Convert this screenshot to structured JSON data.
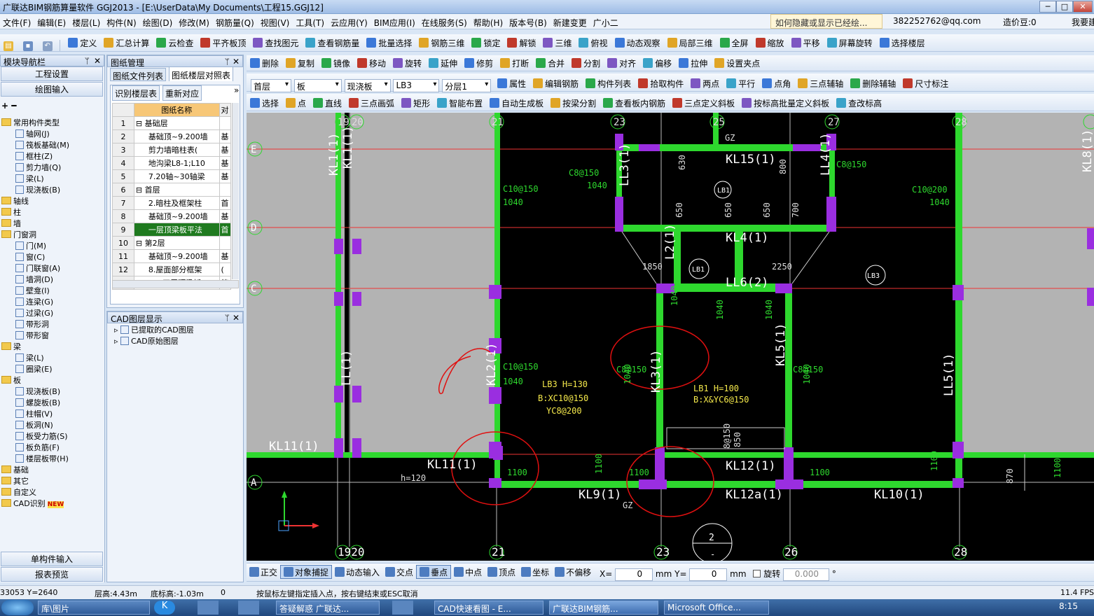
{
  "window": {
    "title": "广联达BIM钢筋算量软件 GGJ2013 - [E:\\UserData\\My Documents\\工程15.GGJ12]",
    "min": "─",
    "max": "□",
    "close": "✕"
  },
  "menu": [
    "文件(F)",
    "编辑(E)",
    "楼层(L)",
    "构件(N)",
    "绘图(D)",
    "修改(M)",
    "钢筋量(Q)",
    "视图(V)",
    "工具(T)",
    "云应用(Y)",
    "BIM应用(I)",
    "在线服务(S)",
    "帮助(H)",
    "版本号(B)",
    "新建变更",
    "广小二"
  ],
  "menu_right": {
    "hint": "如何隐藏或显示已经绘...",
    "account": "382252762@qq.com",
    "beans": "造价豆:0",
    "help": "我要建"
  },
  "toolbar1": [
    "定义",
    "汇总计算",
    "云检查",
    "平齐板顶",
    "查找图元",
    "查看钢筋量",
    "批量选择",
    "钢筋三维",
    "锁定",
    "解锁",
    "三维",
    "俯视",
    "动态观察",
    "局部三维",
    "全屏",
    "缩放",
    "平移",
    "屏幕旋转",
    "选择楼层"
  ],
  "toolbar2": [
    "删除",
    "复制",
    "镜像",
    "移动",
    "旋转",
    "延伸",
    "修剪",
    "打断",
    "合并",
    "分割",
    "对齐",
    "偏移",
    "拉伸",
    "设置夹点"
  ],
  "toolbar3": {
    "floor": "首层",
    "type": "板",
    "subtype": "现浇板",
    "name": "LB3",
    "layer": "分层1",
    "buttons": [
      "属性",
      "编辑钢筋",
      "构件列表",
      "拾取构件",
      "两点",
      "平行",
      "点角",
      "三点辅轴",
      "删除辅轴",
      "尺寸标注"
    ]
  },
  "toolbar4": [
    "选择",
    "点",
    "直线",
    "三点画弧",
    "矩形",
    "智能布置",
    "自动生成板",
    "按梁分割",
    "查看板内钢筋",
    "三点定义斜板",
    "按标高批量定义斜板",
    "查改标高"
  ],
  "nav": {
    "title": "模块导航栏",
    "pin": "ᛘ",
    "close": "✕",
    "btn1": "工程设置",
    "btn2": "绘图输入",
    "btn3": "单构件输入",
    "btn4": "报表预览",
    "tree": [
      {
        "lvl": 0,
        "fold": true,
        "label": "常用构件类型"
      },
      {
        "lvl": 1,
        "label": "轴网(J)"
      },
      {
        "lvl": 1,
        "label": "筏板基础(M)"
      },
      {
        "lvl": 1,
        "label": "框柱(Z)"
      },
      {
        "lvl": 1,
        "label": "剪力墙(Q)"
      },
      {
        "lvl": 1,
        "label": "梁(L)"
      },
      {
        "lvl": 1,
        "label": "现浇板(B)"
      },
      {
        "lvl": 0,
        "fold": true,
        "label": "轴线"
      },
      {
        "lvl": 0,
        "fold": true,
        "label": "柱"
      },
      {
        "lvl": 0,
        "fold": true,
        "label": "墙"
      },
      {
        "lvl": 0,
        "fold": true,
        "label": "门窗洞"
      },
      {
        "lvl": 1,
        "label": "门(M)"
      },
      {
        "lvl": 1,
        "label": "窗(C)"
      },
      {
        "lvl": 1,
        "label": "门联窗(A)"
      },
      {
        "lvl": 1,
        "label": "墙洞(D)"
      },
      {
        "lvl": 1,
        "label": "壁龛(I)"
      },
      {
        "lvl": 1,
        "label": "连梁(G)"
      },
      {
        "lvl": 1,
        "label": "过梁(G)"
      },
      {
        "lvl": 1,
        "label": "带形洞"
      },
      {
        "lvl": 1,
        "label": "带形窗"
      },
      {
        "lvl": 0,
        "fold": true,
        "label": "梁"
      },
      {
        "lvl": 1,
        "label": "梁(L)"
      },
      {
        "lvl": 1,
        "label": "圈梁(E)"
      },
      {
        "lvl": 0,
        "fold": true,
        "label": "板"
      },
      {
        "lvl": 1,
        "label": "现浇板(B)"
      },
      {
        "lvl": 1,
        "label": "螺旋板(B)"
      },
      {
        "lvl": 1,
        "label": "柱帽(V)"
      },
      {
        "lvl": 1,
        "label": "板洞(N)"
      },
      {
        "lvl": 1,
        "label": "板受力筋(S)"
      },
      {
        "lvl": 1,
        "label": "板负筋(F)"
      },
      {
        "lvl": 1,
        "label": "楼层板带(H)"
      },
      {
        "lvl": 0,
        "fold": true,
        "label": "基础"
      },
      {
        "lvl": 0,
        "fold": true,
        "label": "其它"
      },
      {
        "lvl": 0,
        "fold": true,
        "label": "自定义"
      },
      {
        "lvl": 0,
        "fold": true,
        "label": "CAD识别",
        "badge": "NEW"
      }
    ]
  },
  "drawing": {
    "title": "图纸管理",
    "tab1": "图纸文件列表",
    "tab2": "图纸楼层对照表",
    "btn1": "识别楼层表",
    "btn2": "重新对应",
    "col_name": "图纸名称",
    "col2": "对",
    "rows": [
      {
        "n": "1",
        "name": "基础层",
        "c": "",
        "group": true
      },
      {
        "n": "2",
        "name": "基础顶~9.200墙",
        "c": "基"
      },
      {
        "n": "3",
        "name": "剪力墙暗柱表(",
        "c": "基"
      },
      {
        "n": "4",
        "name": "地沟梁L8-1;L10",
        "c": "基"
      },
      {
        "n": "5",
        "name": "7.20轴~30轴梁",
        "c": "基"
      },
      {
        "n": "6",
        "name": "首层",
        "c": "",
        "group": true
      },
      {
        "n": "7",
        "name": "2.暗柱及框架柱",
        "c": "首"
      },
      {
        "n": "8",
        "name": "基础顶~9.200墙",
        "c": "基"
      },
      {
        "n": "9",
        "name": "一层顶梁板平法",
        "c": "首",
        "sel": true
      },
      {
        "n": "10",
        "name": "第2层",
        "c": "",
        "group": true
      },
      {
        "n": "11",
        "name": "基础顶~9.200墙",
        "c": "基"
      },
      {
        "n": "12",
        "name": "8.屋面部分框架",
        "c": "("
      },
      {
        "n": "13",
        "name": "二~四层顶梁板",
        "c": "第"
      }
    ]
  },
  "cadlayer": {
    "title": "CAD图层显示",
    "items": [
      "已提取的CAD图层",
      "CAD原始图层"
    ]
  },
  "cad_labels": {
    "axes_bottom": [
      "1920",
      "21",
      "23",
      "26",
      "28"
    ],
    "axes_top": [
      "19",
      "20",
      "21",
      "23",
      "25",
      "27",
      "28"
    ],
    "axes_left": [
      "E",
      "D",
      "C",
      "A"
    ],
    "beams": [
      "KL15(1)",
      "KL4(1)",
      "LL6(2)",
      "KL3(1)",
      "KL5(1)",
      "KL12(1)",
      "KL11(1)",
      "KL11(1)",
      "KL9(1)",
      "KL12a(1)",
      "KL10(1)",
      "LL5(1)",
      "LL3(1)",
      "LL4(1)",
      "KL1(1)",
      "KL2(1)",
      "KL8(1)",
      "LL(1)",
      "L2(1)",
      "KL1(1)"
    ],
    "slabs": [
      "LB1",
      "LB1",
      "LB3"
    ],
    "rebar": [
      "C8@150",
      "C10@150",
      "C8@150",
      "C10@200",
      "C10@150",
      "C8@150",
      "C8@150",
      "1040",
      "1040",
      "1040",
      "1040",
      "1040",
      "1040",
      "1040",
      "1040",
      "1040",
      "1100",
      "1100",
      "1100",
      "1100",
      "1100",
      "1100",
      "650",
      "650",
      "650",
      "630",
      "800",
      "700",
      "1850",
      "2250",
      "850",
      "870",
      "h=120",
      "GZ",
      "GZ",
      "8@150"
    ],
    "note1": [
      "LB3 H=130",
      "B:XC10@150",
      "YC8@200"
    ],
    "note2": [
      "LB1 H=100",
      "B:X&YC6@150"
    ],
    "section": [
      "2",
      "-"
    ]
  },
  "snapbar": [
    "正交",
    "对象捕捉",
    "动态输入",
    "交点",
    "垂点",
    "中点",
    "顶点",
    "坐标",
    "不偏移"
  ],
  "snapvals": {
    "x": "0",
    "y": "0",
    "mm": "mm",
    "rot": "旋转",
    "rotv": "0.000",
    "deg": "°",
    "xlabel": "X=",
    "ylabel": "Y="
  },
  "status": {
    "coords": "33053 Y=2640",
    "height": "层高:4.43m",
    "bottom": "底标高:-1.03m",
    "zero": "0",
    "msg": "按鼠标左键指定插入点，按右键结束或ESC取消",
    "fps": "11.4 FPS"
  },
  "taskbar": [
    "库\\图片",
    "答疑解惑 广联达...",
    "CAD快速看图 - E...",
    "广联达BIM钢筋...",
    "Microsoft Office..."
  ],
  "clock": "8:15"
}
